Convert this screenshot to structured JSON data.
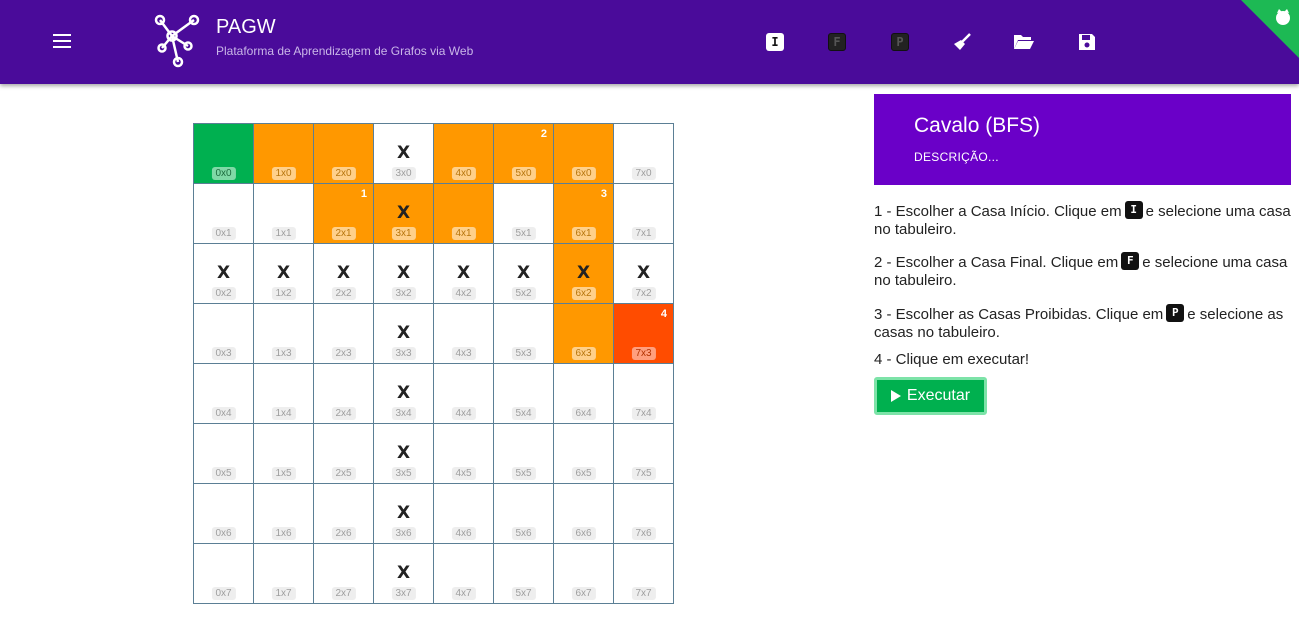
{
  "header": {
    "title": "PAGW",
    "subtitle": "Plataforma de Aprendizagem de Grafos via Web",
    "tools": [
      {
        "name": "start-tool-icon",
        "glyph": "I"
      },
      {
        "name": "final-tool-icon",
        "glyph": "F"
      },
      {
        "name": "forbidden-tool-icon",
        "glyph": "P"
      },
      {
        "name": "broom-icon"
      },
      {
        "name": "folder-open-icon"
      },
      {
        "name": "save-icon"
      }
    ]
  },
  "board": {
    "size": 8,
    "cells": [
      [
        "0x0",
        "green",
        false,
        ""
      ],
      [
        "1x0",
        "orange",
        false,
        ""
      ],
      [
        "2x0",
        "orange",
        false,
        ""
      ],
      [
        "3x0",
        "",
        true,
        ""
      ],
      [
        "4x0",
        "orange",
        false,
        ""
      ],
      [
        "5x0",
        "orange",
        false,
        "2"
      ],
      [
        "6x0",
        "orange",
        false,
        ""
      ],
      [
        "7x0",
        "",
        false,
        ""
      ],
      [
        "0x1",
        "",
        false,
        ""
      ],
      [
        "1x1",
        "",
        false,
        ""
      ],
      [
        "2x1",
        "orange",
        false,
        "1"
      ],
      [
        "3x1",
        "orange",
        true,
        ""
      ],
      [
        "4x1",
        "orange",
        false,
        ""
      ],
      [
        "5x1",
        "",
        false,
        ""
      ],
      [
        "6x1",
        "orange",
        false,
        "3"
      ],
      [
        "7x1",
        "",
        false,
        ""
      ],
      [
        "0x2",
        "",
        true,
        ""
      ],
      [
        "1x2",
        "",
        true,
        ""
      ],
      [
        "2x2",
        "",
        true,
        ""
      ],
      [
        "3x2",
        "",
        true,
        ""
      ],
      [
        "4x2",
        "",
        true,
        ""
      ],
      [
        "5x2",
        "",
        true,
        ""
      ],
      [
        "6x2",
        "orange",
        true,
        ""
      ],
      [
        "7x2",
        "",
        true,
        ""
      ],
      [
        "0x3",
        "",
        false,
        ""
      ],
      [
        "1x3",
        "",
        false,
        ""
      ],
      [
        "2x3",
        "",
        false,
        ""
      ],
      [
        "3x3",
        "",
        true,
        ""
      ],
      [
        "4x3",
        "",
        false,
        ""
      ],
      [
        "5x3",
        "",
        false,
        ""
      ],
      [
        "6x3",
        "orange",
        false,
        ""
      ],
      [
        "7x3",
        "red",
        false,
        "4"
      ],
      [
        "0x4",
        "",
        false,
        ""
      ],
      [
        "1x4",
        "",
        false,
        ""
      ],
      [
        "2x4",
        "",
        false,
        ""
      ],
      [
        "3x4",
        "",
        true,
        ""
      ],
      [
        "4x4",
        "",
        false,
        ""
      ],
      [
        "5x4",
        "",
        false,
        ""
      ],
      [
        "6x4",
        "",
        false,
        ""
      ],
      [
        "7x4",
        "",
        false,
        ""
      ],
      [
        "0x5",
        "",
        false,
        ""
      ],
      [
        "1x5",
        "",
        false,
        ""
      ],
      [
        "2x5",
        "",
        false,
        ""
      ],
      [
        "3x5",
        "",
        true,
        ""
      ],
      [
        "4x5",
        "",
        false,
        ""
      ],
      [
        "5x5",
        "",
        false,
        ""
      ],
      [
        "6x5",
        "",
        false,
        ""
      ],
      [
        "7x5",
        "",
        false,
        ""
      ],
      [
        "0x6",
        "",
        false,
        ""
      ],
      [
        "1x6",
        "",
        false,
        ""
      ],
      [
        "2x6",
        "",
        false,
        ""
      ],
      [
        "3x6",
        "",
        true,
        ""
      ],
      [
        "4x6",
        "",
        false,
        ""
      ],
      [
        "5x6",
        "",
        false,
        ""
      ],
      [
        "6x6",
        "",
        false,
        ""
      ],
      [
        "7x6",
        "",
        false,
        ""
      ],
      [
        "0x7",
        "",
        false,
        ""
      ],
      [
        "1x7",
        "",
        false,
        ""
      ],
      [
        "2x7",
        "",
        false,
        ""
      ],
      [
        "3x7",
        "",
        true,
        ""
      ],
      [
        "4x7",
        "",
        false,
        ""
      ],
      [
        "5x7",
        "",
        false,
        ""
      ],
      [
        "6x7",
        "",
        false,
        ""
      ],
      [
        "7x7",
        "",
        false,
        ""
      ]
    ],
    "blocked_mark": "X"
  },
  "panel": {
    "title": "Cavalo (BFS)",
    "description_link": "DESCRIÇÃO...",
    "step1_before": "1 - Escolher a Casa Início. Clique em",
    "step1_key": "I",
    "step1_after": "e selecione uma casa no tabuleiro.",
    "step2_before": "2 - Escolher a Casa Final. Clique em",
    "step2_key": "F",
    "step2_after": "e selecione uma casa no tabuleiro.",
    "step3_before": "3 - Escolher as Casas Proibidas. Clique em",
    "step3_key": "P",
    "step3_after": "e selecione as casas no tabuleiro.",
    "step4": "4 - Clique em executar!",
    "run_label": "Executar"
  },
  "colors": {
    "header": "#4a0b9a",
    "card": "#6a00c8",
    "path": "#ff9800",
    "start": "#00b050",
    "end": "#ff4c00"
  }
}
